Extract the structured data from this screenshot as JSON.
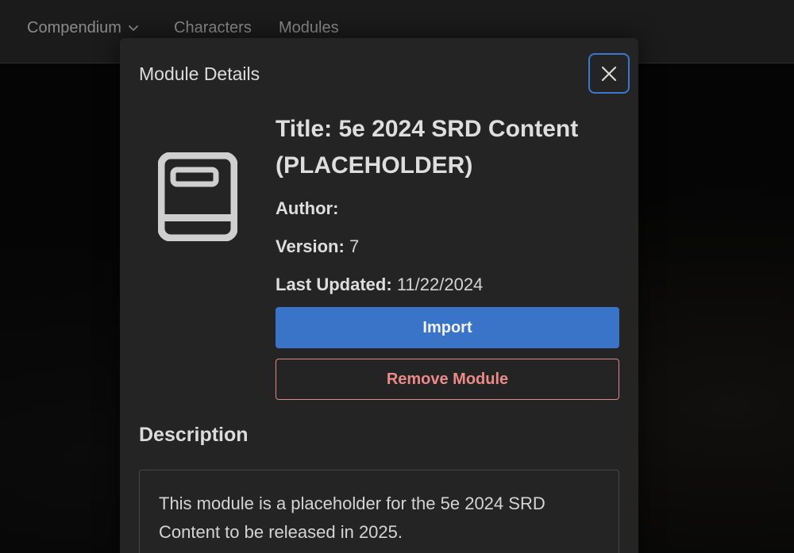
{
  "nav": {
    "items": [
      {
        "label": "Compendium",
        "has_dropdown": true
      },
      {
        "label": "Characters"
      },
      {
        "label": "Modules"
      }
    ]
  },
  "modal": {
    "header": "Module Details",
    "close_icon": "close-icon",
    "module_icon": "book-icon",
    "title": "Title: 5e 2024 SRD Content (PLACEHOLDER)",
    "author_label": "Author:",
    "author_value": "",
    "version_label": "Version:",
    "version_value": "7",
    "updated_label": "Last Updated:",
    "updated_value": "11/22/2024",
    "import_label": "Import",
    "remove_label": "Remove Module",
    "description_heading": "Description",
    "description_text": "This module is a placeholder for the 5e 2024 SRD Content to be released in 2025."
  },
  "colors": {
    "accent": "#3a74c8",
    "danger": "#ec8a8a",
    "focus_ring": "#3a78d0"
  }
}
